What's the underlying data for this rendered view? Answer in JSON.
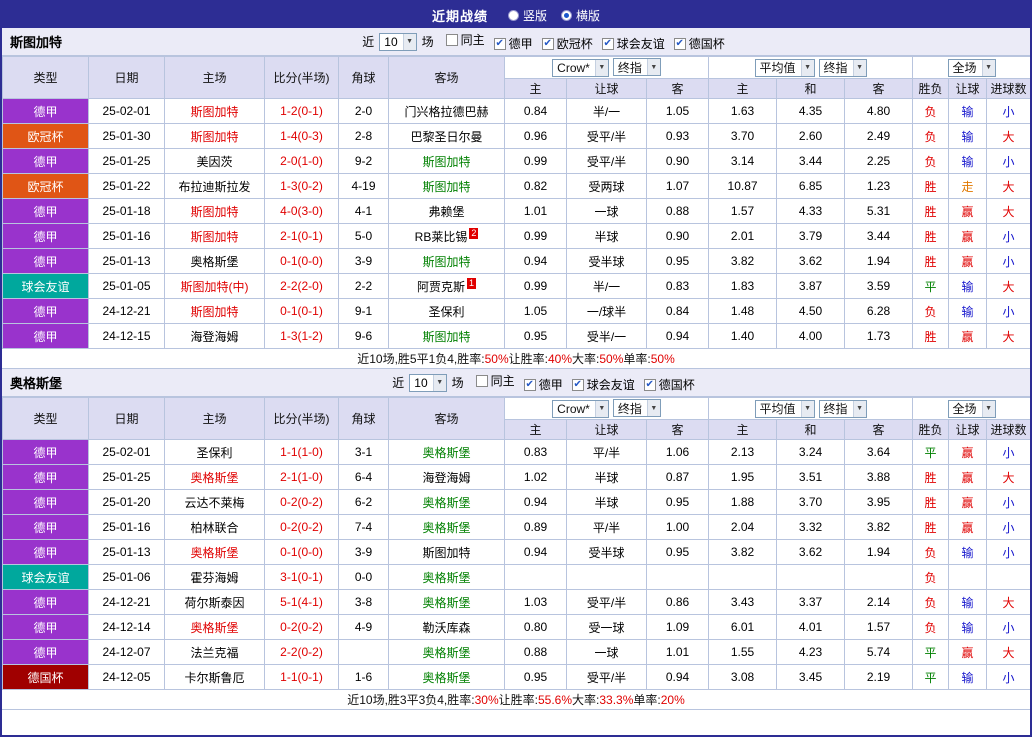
{
  "page": {
    "title": "近期战绩",
    "layout_options": [
      {
        "label": "竖版",
        "selected": false
      },
      {
        "label": "横版",
        "selected": true
      }
    ]
  },
  "filter": {
    "recent_label": "近",
    "games_label": "场"
  },
  "columns": [
    "类型",
    "日期",
    "主场",
    "比分(半场)",
    "角球",
    "客场",
    "主",
    "让球",
    "客",
    "主",
    "和",
    "客",
    "胜负",
    "让球",
    "进球数"
  ],
  "selects": {
    "bookmaker": "Crow*",
    "asian_stage": "终指",
    "europe": "平均值",
    "europe_stage": "终指",
    "scope": "全场"
  },
  "colors": {
    "type_bg": {
      "德甲": "#9933cc",
      "欧冠杯": "#e05515",
      "球会友谊": "#00a89d",
      "德国杯": "#a00000"
    },
    "wdl": {
      "胜": "#e00000",
      "平": "#008000",
      "负": "#e00000"
    },
    "ah": {
      "赢": "#e00000",
      "走": "#e07800",
      "输": "#1414cc"
    },
    "ou": {
      "大": "#e00000",
      "小": "#1414cc"
    },
    "score": "#e00000",
    "home_focus": "#e00000",
    "away_focus": "#008000"
  },
  "sections": [
    {
      "team": "斯图加特",
      "count": "10",
      "filters": [
        {
          "label": "同主",
          "checked": false
        },
        {
          "label": "德甲",
          "checked": true
        },
        {
          "label": "欧冠杯",
          "checked": true
        },
        {
          "label": "球会友谊",
          "checked": true
        },
        {
          "label": "德国杯",
          "checked": true
        }
      ],
      "rows": [
        {
          "type": "德甲",
          "date": "25-02-01",
          "home": "斯图加特",
          "home_focus": true,
          "score": "1-2(0-1)",
          "corner": "2-0",
          "away": "门兴格拉德巴赫",
          "away_focus": false,
          "odds": [
            "0.84",
            "半/一",
            "1.05",
            "1.63",
            "4.35",
            "4.80"
          ],
          "results": [
            "负",
            "输",
            "小"
          ]
        },
        {
          "type": "欧冠杯",
          "date": "25-01-30",
          "home": "斯图加特",
          "home_focus": true,
          "score": "1-4(0-3)",
          "corner": "2-8",
          "away": "巴黎圣日尔曼",
          "away_focus": false,
          "odds": [
            "0.96",
            "受平/半",
            "0.93",
            "3.70",
            "2.60",
            "2.49"
          ],
          "results": [
            "负",
            "输",
            "大"
          ]
        },
        {
          "type": "德甲",
          "date": "25-01-25",
          "home": "美因茨",
          "home_focus": false,
          "score": "2-0(1-0)",
          "corner": "9-2",
          "away": "斯图加特",
          "away_focus": true,
          "odds": [
            "0.99",
            "受平/半",
            "0.90",
            "3.14",
            "3.44",
            "2.25"
          ],
          "results": [
            "负",
            "输",
            "小"
          ]
        },
        {
          "type": "欧冠杯",
          "date": "25-01-22",
          "home": "布拉迪斯拉发",
          "home_focus": false,
          "score": "1-3(0-2)",
          "corner": "4-19",
          "away": "斯图加特",
          "away_focus": true,
          "odds": [
            "0.82",
            "受两球",
            "1.07",
            "10.87",
            "6.85",
            "1.23"
          ],
          "results": [
            "胜",
            "走",
            "大"
          ]
        },
        {
          "type": "德甲",
          "date": "25-01-18",
          "home": "斯图加特",
          "home_focus": true,
          "score": "4-0(3-0)",
          "corner": "4-1",
          "away": "弗赖堡",
          "away_focus": false,
          "odds": [
            "1.01",
            "一球",
            "0.88",
            "1.57",
            "4.33",
            "5.31"
          ],
          "results": [
            "胜",
            "赢",
            "大"
          ]
        },
        {
          "type": "德甲",
          "date": "25-01-16",
          "home": "斯图加特",
          "home_focus": true,
          "score": "2-1(0-1)",
          "corner": "5-0",
          "away": "RB莱比锡",
          "away_badge": "2",
          "away_focus": false,
          "odds": [
            "0.99",
            "半球",
            "0.90",
            "2.01",
            "3.79",
            "3.44"
          ],
          "results": [
            "胜",
            "赢",
            "小"
          ]
        },
        {
          "type": "德甲",
          "date": "25-01-13",
          "home": "奥格斯堡",
          "home_focus": false,
          "score": "0-1(0-0)",
          "corner": "3-9",
          "away": "斯图加特",
          "away_focus": true,
          "odds": [
            "0.94",
            "受半球",
            "0.95",
            "3.82",
            "3.62",
            "1.94"
          ],
          "results": [
            "胜",
            "赢",
            "小"
          ]
        },
        {
          "type": "球会友谊",
          "date": "25-01-05",
          "home": "斯图加特(中)",
          "home_focus": true,
          "score": "2-2(2-0)",
          "corner": "2-2",
          "away": "阿贾克斯",
          "away_badge": "1",
          "away_focus": false,
          "odds": [
            "0.99",
            "半/一",
            "0.83",
            "1.83",
            "3.87",
            "3.59"
          ],
          "results": [
            "平",
            "输",
            "大"
          ]
        },
        {
          "type": "德甲",
          "date": "24-12-21",
          "home": "斯图加特",
          "home_focus": true,
          "score": "0-1(0-1)",
          "corner": "9-1",
          "away": "圣保利",
          "away_focus": false,
          "odds": [
            "1.05",
            "一/球半",
            "0.84",
            "1.48",
            "4.50",
            "6.28"
          ],
          "results": [
            "负",
            "输",
            "小"
          ]
        },
        {
          "type": "德甲",
          "date": "24-12-15",
          "home": "海登海姆",
          "home_focus": false,
          "score": "1-3(1-2)",
          "corner": "9-6",
          "away": "斯图加特",
          "away_focus": true,
          "odds": [
            "0.95",
            "受半/一",
            "0.94",
            "1.40",
            "4.00",
            "1.73"
          ],
          "results": [
            "胜",
            "赢",
            "大"
          ]
        }
      ],
      "summary": [
        {
          "text": "近10场,胜5平1负4, ",
          "red": false
        },
        {
          "text": "胜率:",
          "red": false
        },
        {
          "text": "50%",
          "red": true
        },
        {
          "text": " 让胜率:",
          "red": false
        },
        {
          "text": "40%",
          "red": true
        },
        {
          "text": " 大率:",
          "red": false
        },
        {
          "text": "50%",
          "red": true
        },
        {
          "text": " 单率:",
          "red": false
        },
        {
          "text": "50%",
          "red": true
        }
      ]
    },
    {
      "team": "奥格斯堡",
      "count": "10",
      "filters": [
        {
          "label": "同主",
          "checked": false
        },
        {
          "label": "德甲",
          "checked": true
        },
        {
          "label": "球会友谊",
          "checked": true
        },
        {
          "label": "德国杯",
          "checked": true
        }
      ],
      "rows": [
        {
          "type": "德甲",
          "date": "25-02-01",
          "home": "圣保利",
          "home_focus": false,
          "score": "1-1(1-0)",
          "corner": "3-1",
          "away": "奥格斯堡",
          "away_focus": true,
          "odds": [
            "0.83",
            "平/半",
            "1.06",
            "2.13",
            "3.24",
            "3.64"
          ],
          "results": [
            "平",
            "赢",
            "小"
          ]
        },
        {
          "type": "德甲",
          "date": "25-01-25",
          "home": "奥格斯堡",
          "home_focus": true,
          "score": "2-1(1-0)",
          "corner": "6-4",
          "away": "海登海姆",
          "away_focus": false,
          "odds": [
            "1.02",
            "半球",
            "0.87",
            "1.95",
            "3.51",
            "3.88"
          ],
          "results": [
            "胜",
            "赢",
            "大"
          ]
        },
        {
          "type": "德甲",
          "date": "25-01-20",
          "home": "云达不莱梅",
          "home_focus": false,
          "score": "0-2(0-2)",
          "corner": "6-2",
          "away": "奥格斯堡",
          "away_focus": true,
          "odds": [
            "0.94",
            "半球",
            "0.95",
            "1.88",
            "3.70",
            "3.95"
          ],
          "results": [
            "胜",
            "赢",
            "小"
          ]
        },
        {
          "type": "德甲",
          "date": "25-01-16",
          "home": "柏林联合",
          "home_focus": false,
          "score": "0-2(0-2)",
          "corner": "7-4",
          "away": "奥格斯堡",
          "away_focus": true,
          "odds": [
            "0.89",
            "平/半",
            "1.00",
            "2.04",
            "3.32",
            "3.82"
          ],
          "results": [
            "胜",
            "赢",
            "小"
          ]
        },
        {
          "type": "德甲",
          "date": "25-01-13",
          "home": "奥格斯堡",
          "home_focus": true,
          "score": "0-1(0-0)",
          "corner": "3-9",
          "away": "斯图加特",
          "away_focus": false,
          "odds": [
            "0.94",
            "受半球",
            "0.95",
            "3.82",
            "3.62",
            "1.94"
          ],
          "results": [
            "负",
            "输",
            "小"
          ]
        },
        {
          "type": "球会友谊",
          "date": "25-01-06",
          "home": "霍芬海姆",
          "home_focus": false,
          "score": "3-1(0-1)",
          "corner": "0-0",
          "away": "奥格斯堡",
          "away_focus": true,
          "odds": [
            "",
            "",
            "",
            "",
            "",
            ""
          ],
          "results": [
            "负",
            "",
            ""
          ]
        },
        {
          "type": "德甲",
          "date": "24-12-21",
          "home": "荷尔斯泰因",
          "home_focus": false,
          "score": "5-1(4-1)",
          "corner": "3-8",
          "away": "奥格斯堡",
          "away_focus": true,
          "odds": [
            "1.03",
            "受平/半",
            "0.86",
            "3.43",
            "3.37",
            "2.14"
          ],
          "results": [
            "负",
            "输",
            "大"
          ]
        },
        {
          "type": "德甲",
          "date": "24-12-14",
          "home": "奥格斯堡",
          "home_focus": true,
          "score": "0-2(0-2)",
          "corner": "4-9",
          "away": "勒沃库森",
          "away_focus": false,
          "odds": [
            "0.80",
            "受一球",
            "1.09",
            "6.01",
            "4.01",
            "1.57"
          ],
          "results": [
            "负",
            "输",
            "小"
          ]
        },
        {
          "type": "德甲",
          "date": "24-12-07",
          "home": "法兰克福",
          "home_focus": false,
          "score": "2-2(0-2)",
          "corner": "",
          "away": "奥格斯堡",
          "away_focus": true,
          "odds": [
            "0.88",
            "一球",
            "1.01",
            "1.55",
            "4.23",
            "5.74"
          ],
          "results": [
            "平",
            "赢",
            "大"
          ]
        },
        {
          "type": "德国杯",
          "date": "24-12-05",
          "home": "卡尔斯鲁厄",
          "home_focus": false,
          "score": "1-1(0-1)",
          "corner": "1-6",
          "away": "奥格斯堡",
          "away_focus": true,
          "odds": [
            "0.95",
            "受平/半",
            "0.94",
            "3.08",
            "3.45",
            "2.19"
          ],
          "results": [
            "平",
            "输",
            "小"
          ]
        }
      ],
      "summary": [
        {
          "text": "近10场,胜3平3负4, ",
          "red": false
        },
        {
          "text": "胜率:",
          "red": false
        },
        {
          "text": "30%",
          "red": true
        },
        {
          "text": " 让胜率:",
          "red": false
        },
        {
          "text": "55.6%",
          "red": true
        },
        {
          "text": " 大率:",
          "red": false
        },
        {
          "text": "33.3%",
          "red": true
        },
        {
          "text": " 单率:",
          "red": false
        },
        {
          "text": "20%",
          "red": true
        }
      ]
    }
  ]
}
